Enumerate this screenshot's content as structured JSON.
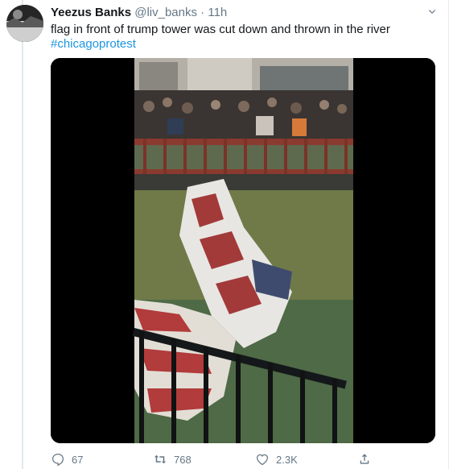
{
  "tweet": {
    "display_name": "Yeezus Banks",
    "handle": "@liv_banks",
    "separator": "·",
    "time": "11h",
    "text": "flag in front of trump tower was cut down and thrown in the river",
    "hashtag": "#chicagoprotest"
  },
  "actions": {
    "reply_count": "67",
    "retweet_count": "768",
    "like_count": "2.3K"
  },
  "icons": {
    "reply": "reply-icon",
    "retweet": "retweet-icon",
    "like": "heart-icon",
    "share": "share-icon",
    "more": "chevron-down-icon"
  },
  "colors": {
    "text": "#14171a",
    "secondary": "#657786",
    "link": "#1b95e0",
    "thread_line": "#e1e8ed"
  }
}
